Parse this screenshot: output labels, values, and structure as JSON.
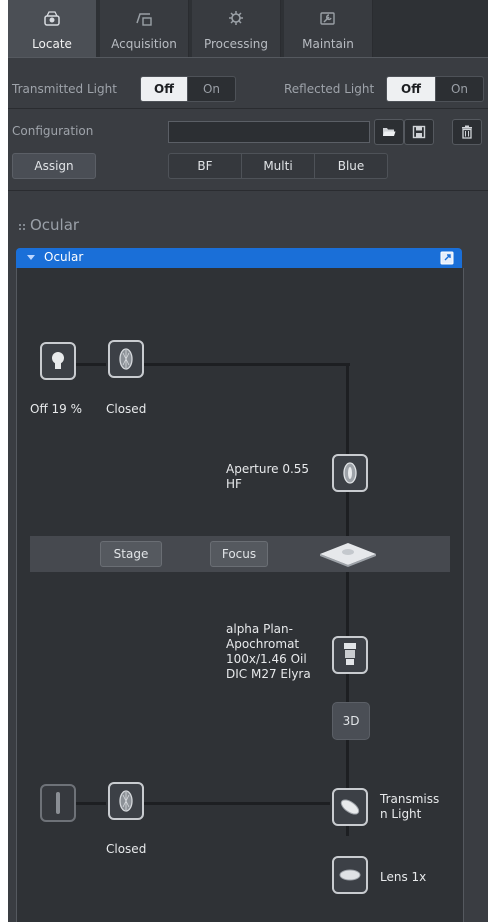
{
  "tabs": [
    {
      "label": "Locate",
      "icon": "microscope-icon",
      "active": true
    },
    {
      "label": "Acquisition",
      "icon": "camera-icon",
      "active": false
    },
    {
      "label": "Processing",
      "icon": "gear-icon",
      "active": false
    },
    {
      "label": "Maintain",
      "icon": "wrench-icon",
      "active": false
    }
  ],
  "light": {
    "transmitted_label": "Transmitted Light",
    "reflected_label": "Reflected Light",
    "off_label": "Off",
    "on_label": "On"
  },
  "config": {
    "label": "Configuration",
    "value": "",
    "assign_label": "Assign",
    "presets": [
      "BF",
      "Multi",
      "Blue"
    ]
  },
  "ocular": {
    "section_title": "Ocular",
    "bar_label": "Ocular",
    "lamp_status": "Off 19 %",
    "shutter_top_status": "Closed",
    "aperture_label": "Aperture 0.55\nHF",
    "stage_label": "Stage",
    "focus_label": "Focus",
    "objective_label": "alpha Plan-\nApochromat\n100x/1.46 Oil\nDIC M27 Elyra",
    "btn_3d": "3D",
    "transmission_label": "Transmiss\nn Light",
    "shutter_bottom_status": "Closed",
    "lens_label": "Lens 1x"
  },
  "colors": {
    "accent_blue": "#1a6fd8",
    "panel_bg": "#2f3236"
  }
}
